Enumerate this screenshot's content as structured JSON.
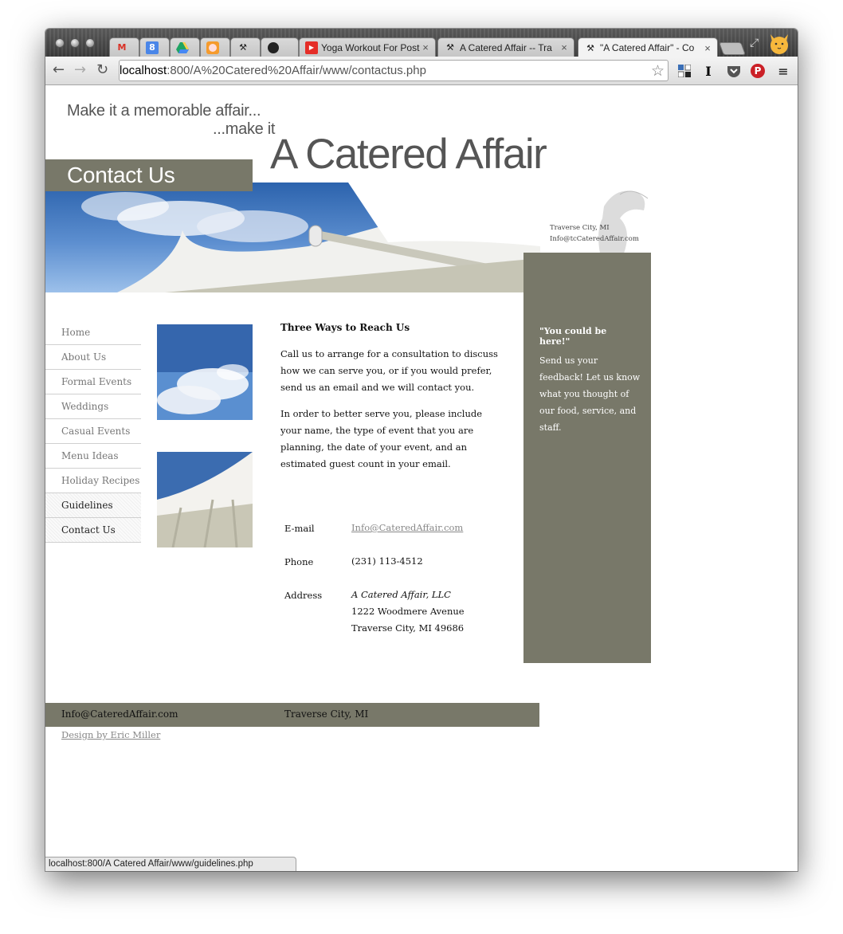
{
  "browser": {
    "tabs": [
      {
        "title": "",
        "icon": "gmail-icon"
      },
      {
        "title": "",
        "icon": "calendar-icon"
      },
      {
        "title": "",
        "icon": "drive-icon"
      },
      {
        "title": "",
        "icon": "orange-circle-icon"
      },
      {
        "title": "",
        "icon": "tool-icon"
      },
      {
        "title": "",
        "icon": "github-icon"
      },
      {
        "title": "Yoga Workout For Post",
        "icon": "youtube-icon"
      },
      {
        "title": "A Catered Affair -- Tra",
        "icon": "tool-icon"
      },
      {
        "title": "\"A Catered Affair\" - Co",
        "icon": "tool-icon"
      }
    ],
    "close_glyph": "×",
    "url_host": "localhost",
    "url_rest": ":800/A%20Catered%20Affair/www/contactus.php",
    "status_text": "localhost:800/A Catered Affair/www/guidelines.php"
  },
  "site": {
    "tagline1": "Make it a memorable affair...",
    "tagline2": "...make it",
    "brand": "A Catered Affair",
    "page_title": "Contact Us",
    "side_city": "Traverse City, MI",
    "side_email": "Info@tcCateredAffair.com",
    "quote": "\"You could be here!\"",
    "feedback": "Send us your feedback! Let us know what you thought of our food, service, and staff.",
    "nav": [
      {
        "label": "Home",
        "dark": false
      },
      {
        "label": "About Us",
        "dark": false
      },
      {
        "label": "Formal Events",
        "dark": false
      },
      {
        "label": "Weddings",
        "dark": false
      },
      {
        "label": "Casual Events",
        "dark": false
      },
      {
        "label": "Menu Ideas",
        "dark": false
      },
      {
        "label": "Holiday Recipes",
        "dark": false
      },
      {
        "label": "Guidelines",
        "dark": true
      },
      {
        "label": "Contact Us",
        "dark": true
      }
    ],
    "heading": "Three Ways to Reach Us",
    "para1": "Call us to arrange for a consultation to discuss how we can serve you, or if you would prefer, send us an email and we will contact you.",
    "para2": "In order to better serve you, please include your name, the type of event that you are planning, the date of your event, and an estimated guest count in your email.",
    "contact": {
      "email_label": "E-mail",
      "email": "Info@CateredAffair.com",
      "phone_label": "Phone",
      "phone": "(231) 113-4512",
      "address_label": "Address",
      "company": "A Catered Affair, LLC",
      "street": "1222 Woodmere Avenue",
      "city": "Traverse City, MI 49686"
    },
    "footer_email": "Info@CateredAffair.com",
    "footer_city": "Traverse City, MI",
    "design_credit": "Design by Eric Miller"
  },
  "colors": {
    "accent": "#787869",
    "sky": "#2c63ad"
  }
}
